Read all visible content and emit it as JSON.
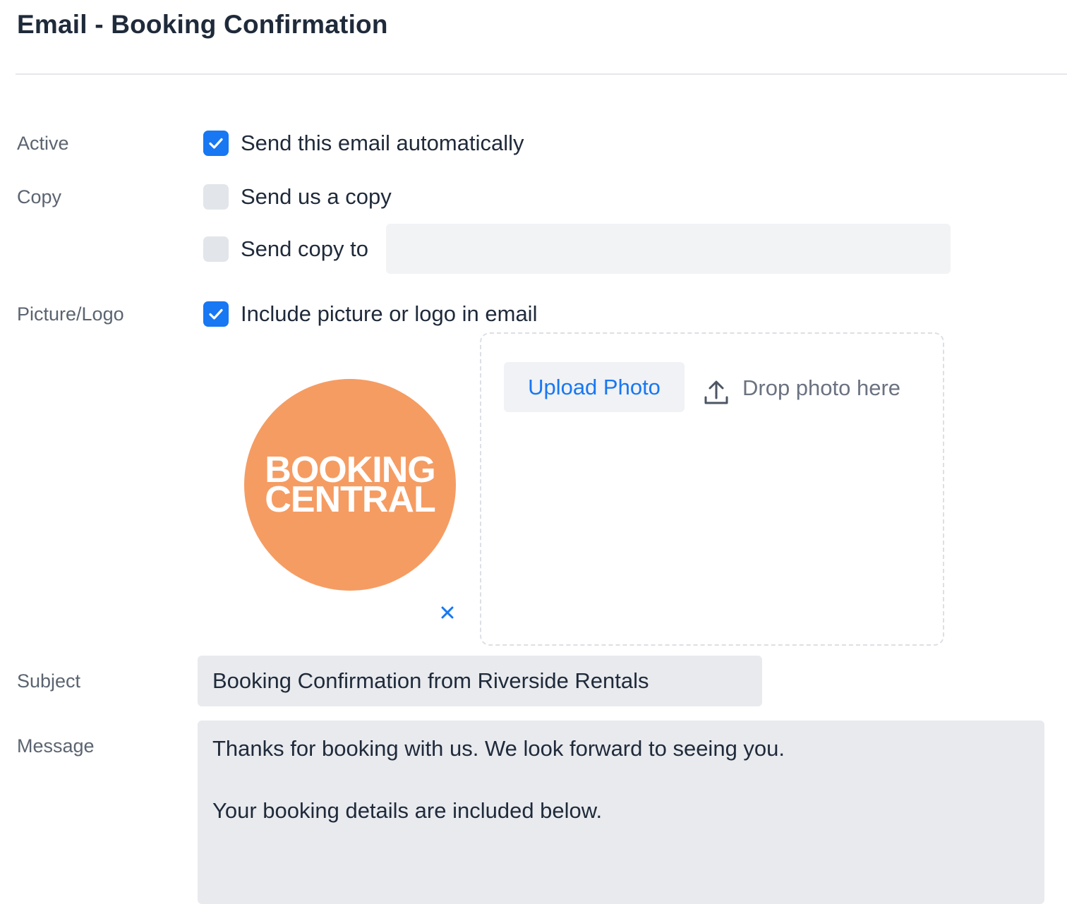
{
  "page": {
    "title": "Email - Booking Confirmation"
  },
  "form": {
    "active": {
      "label": "Active",
      "checkbox_label": "Send this email automatically",
      "checked": true
    },
    "copy": {
      "label": "Copy",
      "send_us_copy_label": "Send us a copy",
      "send_us_copy_checked": false,
      "send_copy_to_label": "Send copy to",
      "send_copy_to_checked": false,
      "send_copy_to_value": ""
    },
    "picture": {
      "label": "Picture/Logo",
      "checkbox_label": "Include picture or logo in email",
      "checked": true,
      "logo_line1": "BOOKING",
      "logo_line2": "CENTRAL",
      "upload_button": "Upload Photo",
      "drop_text": "Drop photo here"
    },
    "subject": {
      "label": "Subject",
      "value": "Booking Confirmation from Riverside Rentals"
    },
    "message": {
      "label": "Message",
      "lines": [
        "Thanks for booking with us. We look forward to seeing you.",
        "",
        "Your booking details are included below."
      ]
    }
  },
  "icons": {
    "check": "checkmark-icon",
    "upload": "upload-icon",
    "remove": "close-icon"
  },
  "colors": {
    "accent": "#1877f2",
    "logo_bg": "#f59c63",
    "title": "#1f2a3a",
    "label": "#5b6470"
  }
}
